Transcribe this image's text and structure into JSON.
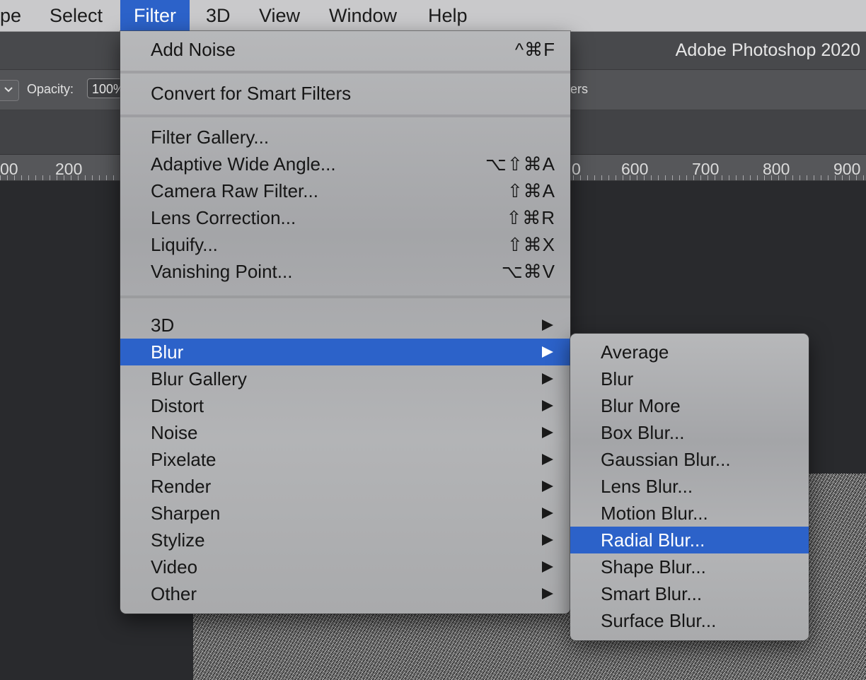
{
  "menubar": {
    "items": [
      {
        "label": "pe"
      },
      {
        "label": "Select"
      },
      {
        "label": "Filter"
      },
      {
        "label": "3D"
      },
      {
        "label": "View"
      },
      {
        "label": "Window"
      },
      {
        "label": "Help"
      }
    ]
  },
  "titlebar": {
    "title": "Adobe Photoshop 2020"
  },
  "options": {
    "opacity_label": "Opacity:",
    "opacity_value": "100%",
    "tail_text": "ers"
  },
  "ruler": {
    "labels": [
      "00",
      "200",
      "0",
      "600",
      "700",
      "800",
      "900"
    ]
  },
  "filter_menu": {
    "last_filter": {
      "label": "Add Noise",
      "shortcut": "^⌘F"
    },
    "convert": {
      "label": "Convert for Smart Filters"
    },
    "special": [
      {
        "label": "Filter Gallery...",
        "shortcut": ""
      },
      {
        "label": "Adaptive Wide Angle...",
        "shortcut": "⌥⇧⌘A"
      },
      {
        "label": "Camera Raw Filter...",
        "shortcut": "⇧⌘A"
      },
      {
        "label": "Lens Correction...",
        "shortcut": "⇧⌘R"
      },
      {
        "label": "Liquify...",
        "shortcut": "⇧⌘X"
      },
      {
        "label": "Vanishing Point...",
        "shortcut": "⌥⌘V"
      }
    ],
    "submenus": [
      {
        "label": "3D"
      },
      {
        "label": "Blur"
      },
      {
        "label": "Blur Gallery"
      },
      {
        "label": "Distort"
      },
      {
        "label": "Noise"
      },
      {
        "label": "Pixelate"
      },
      {
        "label": "Render"
      },
      {
        "label": "Sharpen"
      },
      {
        "label": "Stylize"
      },
      {
        "label": "Video"
      },
      {
        "label": "Other"
      }
    ]
  },
  "blur_submenu": {
    "items": [
      {
        "label": "Average"
      },
      {
        "label": "Blur"
      },
      {
        "label": "Blur More"
      },
      {
        "label": "Box Blur..."
      },
      {
        "label": "Gaussian Blur..."
      },
      {
        "label": "Lens Blur..."
      },
      {
        "label": "Motion Blur..."
      },
      {
        "label": "Radial Blur..."
      },
      {
        "label": "Shape Blur..."
      },
      {
        "label": "Smart Blur..."
      },
      {
        "label": "Surface Blur..."
      }
    ]
  },
  "colors": {
    "highlight": "#2c62c9",
    "menu_bg": "#b0b1b3",
    "canvas": "#292a2d"
  }
}
